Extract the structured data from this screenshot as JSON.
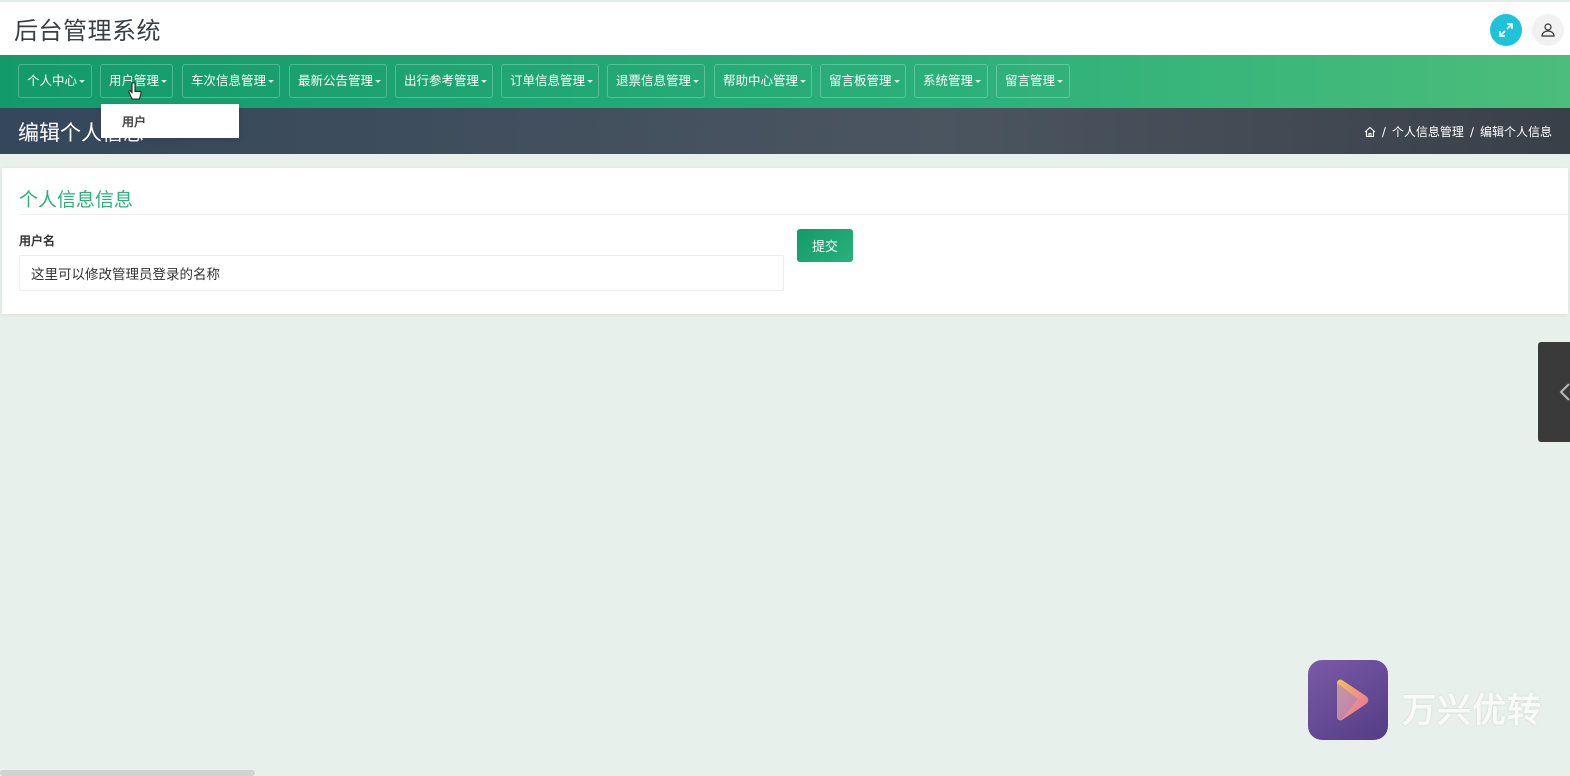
{
  "app_title": "后台管理系统",
  "nav": {
    "items": [
      {
        "label": "个人中心"
      },
      {
        "label": "用户管理"
      },
      {
        "label": "车次信息管理"
      },
      {
        "label": "最新公告管理"
      },
      {
        "label": "出行参考管理"
      },
      {
        "label": "订单信息管理"
      },
      {
        "label": "退票信息管理"
      },
      {
        "label": "帮助中心管理"
      },
      {
        "label": "留言板管理"
      },
      {
        "label": "系统管理"
      },
      {
        "label": "留言管理"
      }
    ],
    "dropdown": {
      "items": [
        {
          "label": "用户"
        }
      ]
    }
  },
  "page": {
    "title": "编辑个人信息",
    "breadcrumb": [
      "个人信息管理",
      "编辑个人信息"
    ]
  },
  "form": {
    "section_title": "个人信息信息",
    "username_label": "用户名",
    "username_value": "这里可以修改管理员登录的名称",
    "submit_label": "提交"
  },
  "watermark": {
    "text": "万兴优转"
  },
  "colors": {
    "accent": "#2bb07a",
    "nav_bg": "#139a6b",
    "header_bg": "#34475b",
    "fullscreen_btn": "#1ec3d9"
  }
}
